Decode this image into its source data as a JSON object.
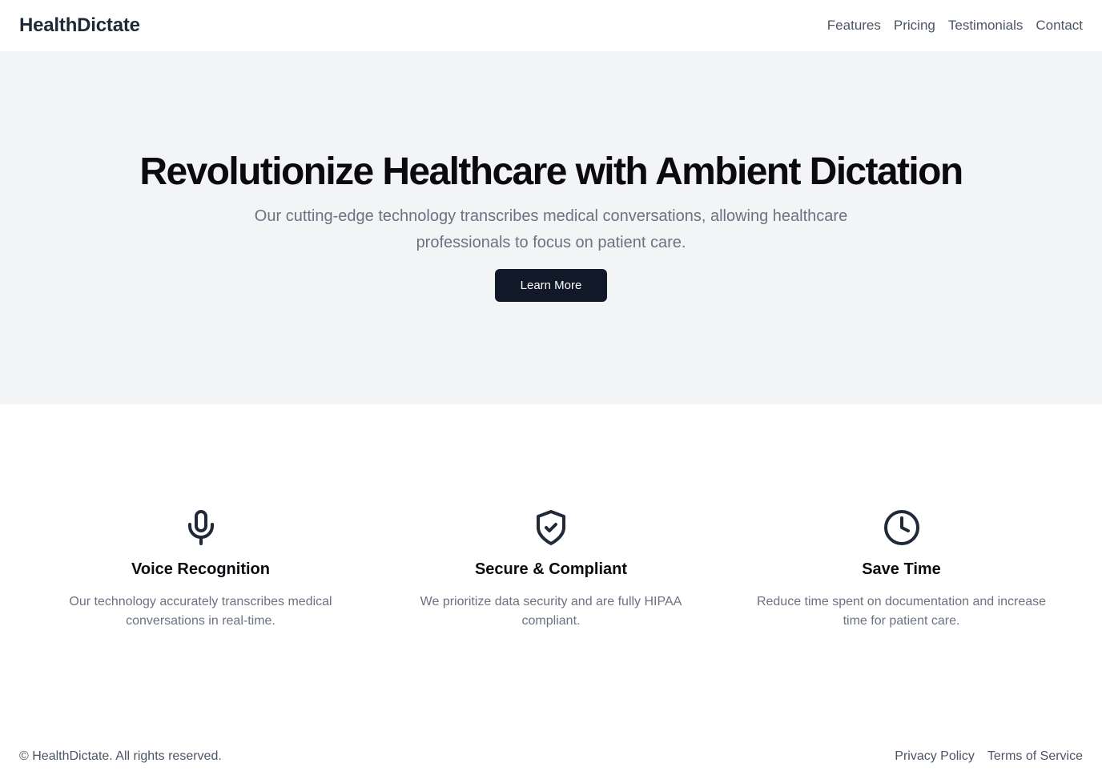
{
  "header": {
    "brand": "HealthDictate",
    "nav": [
      "Features",
      "Pricing",
      "Testimonials",
      "Contact"
    ]
  },
  "hero": {
    "title": "Revolutionize Healthcare with Ambient Dictation",
    "subtitle": "Our cutting-edge technology transcribes medical conversations, allowing healthcare professionals to focus on patient care.",
    "cta_label": "Learn More"
  },
  "features": [
    {
      "icon": "microphone-icon",
      "title": "Voice Recognition",
      "description": "Our technology accurately transcribes medical conversations in real-time."
    },
    {
      "icon": "shield-check-icon",
      "title": "Secure & Compliant",
      "description": "We prioritize data security and are fully HIPAA compliant."
    },
    {
      "icon": "clock-icon",
      "title": "Save Time",
      "description": "Reduce time spent on documentation and increase time for patient care."
    }
  ],
  "footer": {
    "copyright": "© HealthDictate. All rights reserved.",
    "links": [
      "Privacy Policy",
      "Terms of Service"
    ]
  },
  "colors": {
    "primary_button": "#111827",
    "hero_background": "#f2f4f6",
    "muted_text": "#6b7280"
  }
}
